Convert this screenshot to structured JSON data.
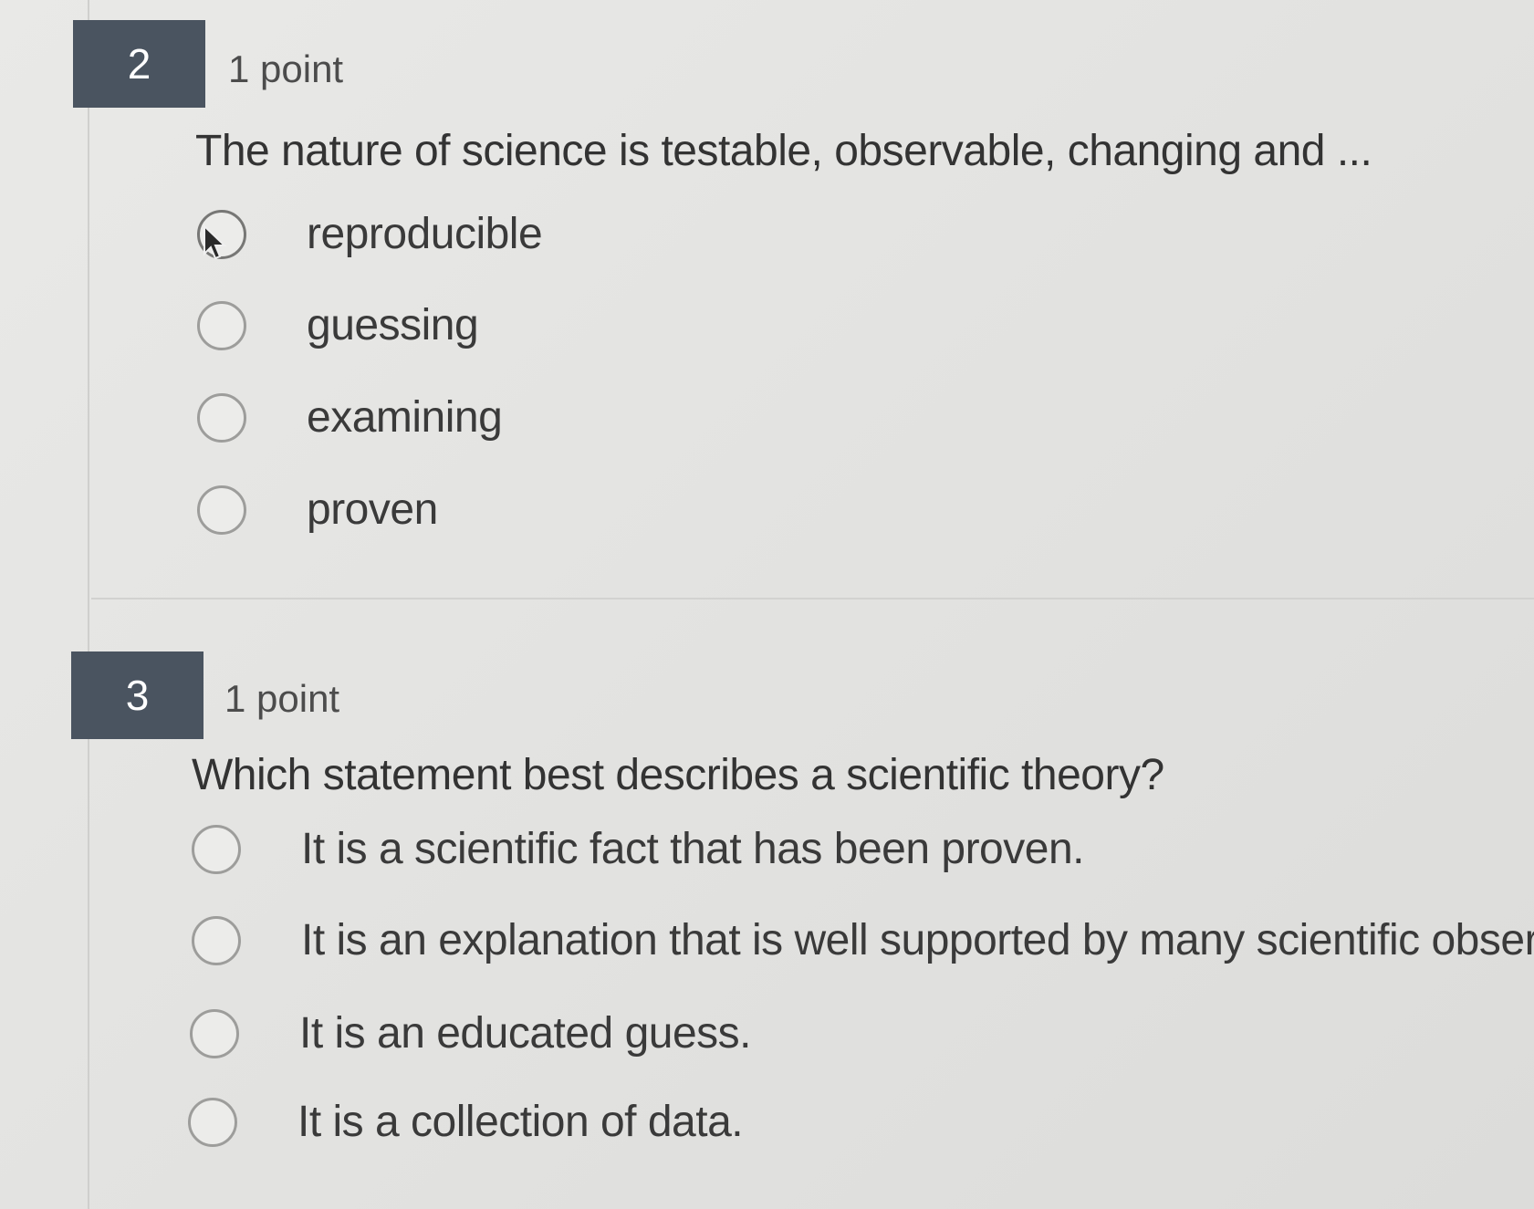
{
  "questions": [
    {
      "number": "2",
      "points": "1 point",
      "prompt": "The nature of science is testable, observable, changing and ...",
      "options": [
        {
          "label": "reproducible"
        },
        {
          "label": "guessing"
        },
        {
          "label": "examining"
        },
        {
          "label": "proven"
        }
      ]
    },
    {
      "number": "3",
      "points": "1 point",
      "prompt": "Which statement best describes a scientific theory?",
      "options": [
        {
          "label": "It is a scientific fact that has been proven."
        },
        {
          "label": "It is an explanation that is well supported by many scientific obser"
        },
        {
          "label": "It is an educated guess."
        },
        {
          "label": "It is a collection of data."
        }
      ]
    }
  ],
  "icons": {
    "cursor": "mouse-pointer-icon",
    "radio": "radio-unselected-icon"
  }
}
